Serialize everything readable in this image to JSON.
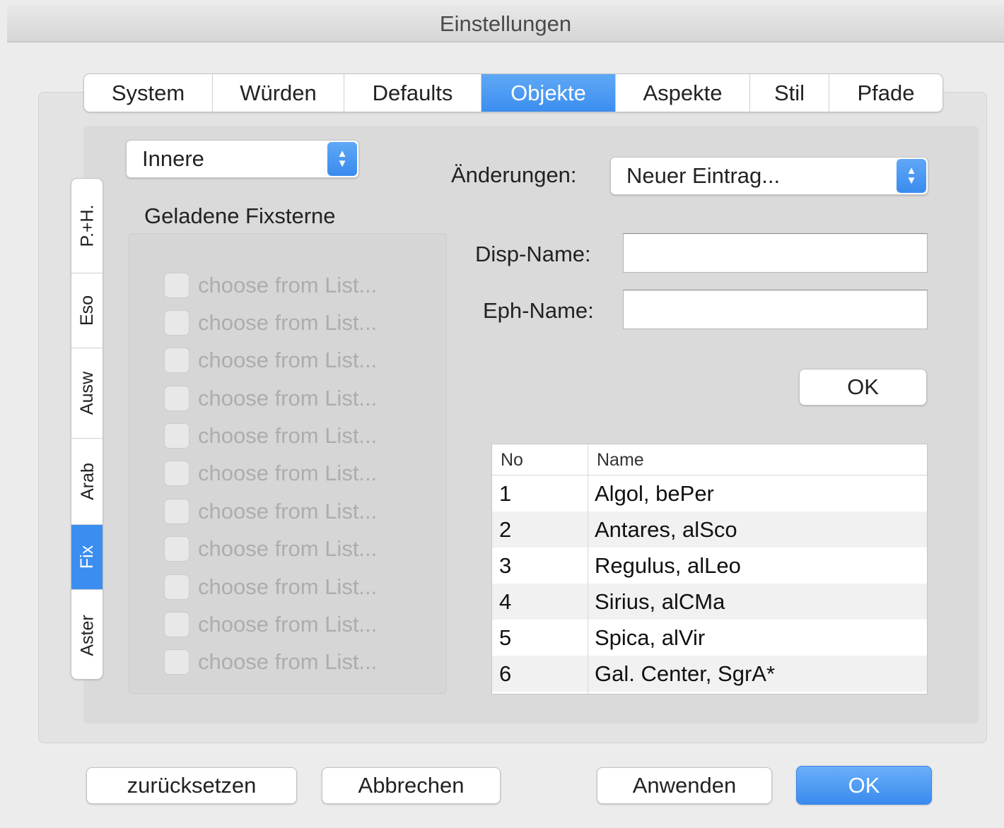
{
  "window": {
    "title": "Einstellungen"
  },
  "top_tabs": [
    {
      "label": "System",
      "active": false
    },
    {
      "label": "Würden",
      "active": false
    },
    {
      "label": "Defaults",
      "active": false
    },
    {
      "label": "Objekte",
      "active": true
    },
    {
      "label": "Aspekte",
      "active": false
    },
    {
      "label": "Stil",
      "active": false
    },
    {
      "label": "Pfade",
      "active": false
    }
  ],
  "side_tabs": [
    {
      "label": "P.+H.",
      "active": false
    },
    {
      "label": "Eso",
      "active": false
    },
    {
      "label": "Ausw",
      "active": false
    },
    {
      "label": "Arab",
      "active": false
    },
    {
      "label": "Fix",
      "active": true
    },
    {
      "label": "Aster",
      "active": false
    }
  ],
  "left": {
    "selector_value": "Innere",
    "group_title": "Geladene Fixsterne",
    "checkbox_items": [
      "choose from List...",
      "choose from List...",
      "choose from List...",
      "choose from List...",
      "choose from List...",
      "choose from List...",
      "choose from List...",
      "choose from List...",
      "choose from List...",
      "choose from List...",
      "choose from List..."
    ]
  },
  "right": {
    "changes_label": "Änderungen:",
    "changes_value": "Neuer Eintrag...",
    "disp_name_label": "Disp-Name:",
    "disp_name_value": "",
    "eph_name_label": "Eph-Name:",
    "eph_name_value": "",
    "ok_label": "OK",
    "table": {
      "columns": [
        "No",
        "Name"
      ],
      "rows": [
        [
          "1",
          "Algol, bePer"
        ],
        [
          "2",
          "Antares, alSco"
        ],
        [
          "3",
          "Regulus, alLeo"
        ],
        [
          "4",
          "Sirius, alCMa"
        ],
        [
          "5",
          "Spica, alVir"
        ],
        [
          "6",
          "Gal. Center, SgrA*"
        ]
      ]
    }
  },
  "footer": {
    "reset_label": "zurücksetzen",
    "cancel_label": "Abbrechen",
    "apply_label": "Anwenden",
    "ok_label": "OK"
  },
  "colors": {
    "accent": "#3b8ef0",
    "disabled_text": "#adadad"
  }
}
